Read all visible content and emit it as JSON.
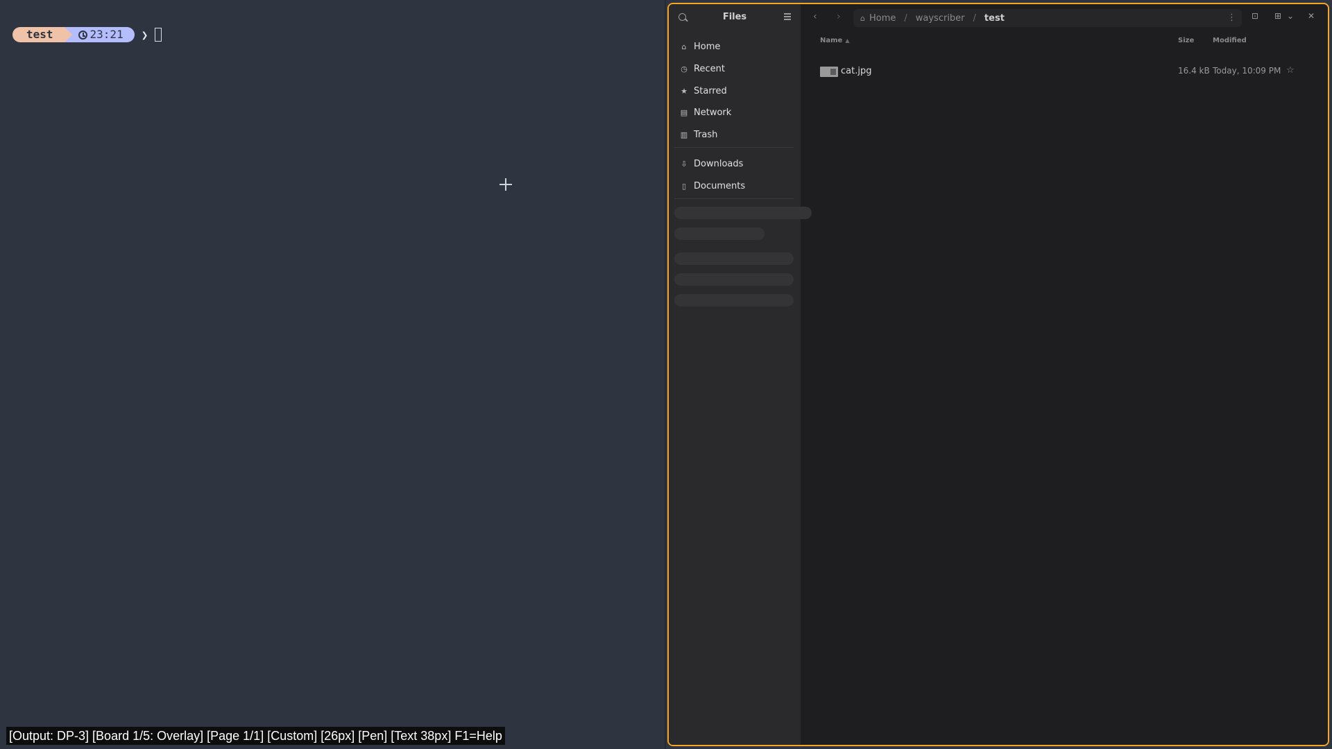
{
  "terminal": {
    "prompt_dir": "test",
    "prompt_time": "23:21",
    "prompt_symbol": "❯",
    "status": "[Output: DP-3] [Board 1/5: Overlay] [Page 1/1] [Custom] [26px] [Pen] [Text 38px]  F1=Help"
  },
  "files": {
    "title": "Files",
    "sidebar": {
      "places": [
        {
          "label": "Home",
          "icon": "home-icon"
        },
        {
          "label": "Recent",
          "icon": "clock-icon"
        },
        {
          "label": "Starred",
          "icon": "star-icon"
        },
        {
          "label": "Network",
          "icon": "network-icon"
        },
        {
          "label": "Trash",
          "icon": "trash-icon"
        }
      ],
      "bookmarks": [
        {
          "label": "Downloads",
          "icon": "download-icon"
        },
        {
          "label": "Documents",
          "icon": "document-icon"
        }
      ]
    },
    "path": [
      "Home",
      "wayscriber",
      "test"
    ],
    "columns": {
      "name": "Name",
      "size": "Size",
      "modified": "Modified"
    },
    "rows": [
      {
        "name": "cat.jpg",
        "size": "16.4 kB",
        "modified": "Today, 10:09 PM"
      }
    ]
  },
  "colors": {
    "window_border": "#f5a623",
    "terminal_bg": "#2e3440",
    "prompt_dir_bg": "#f0c3a8",
    "prompt_time_bg": "#b4befe"
  }
}
